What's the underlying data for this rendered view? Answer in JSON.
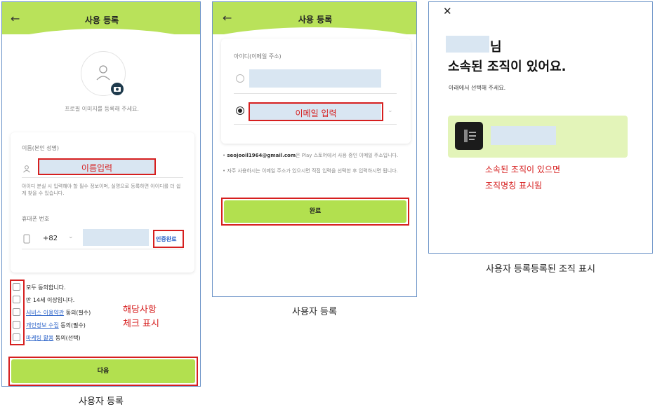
{
  "screen1": {
    "title": "사용 등록",
    "back_icon": "←",
    "profile_hint": "프로필 이미지를 등록해 주세요.",
    "name_label": "이름(본인 성명)",
    "name_annotation": "이름입력",
    "name_help": "아이디 분실 시 입력해야 할 필수 정보이며, 실명으로 등록하면 아이디를 더 쉽게 찾을 수 있습니다.",
    "phone_label": "휴대폰 번호",
    "country_code": "+82",
    "verify_button": "인증완료",
    "agreements": [
      {
        "link": "",
        "text": "모두 동의합니다."
      },
      {
        "link": "",
        "text": "만 14세 이상입니다."
      },
      {
        "link": "서비스 이용약관",
        "text": " 동의(필수)"
      },
      {
        "link": "개인정보 수집",
        "text": " 동의(필수)"
      },
      {
        "link": "마케팅 활용",
        "text": " 동의(선택)"
      }
    ],
    "check_annotation_line1": "해당사항",
    "check_annotation_line2": "체크 표시",
    "next_button": "다음",
    "caption": "사용자 등록"
  },
  "screen2": {
    "title": "사용 등록",
    "back_icon": "←",
    "id_label": "아이디(이메일 주소)",
    "email_annotation": "이메일 입력",
    "note1_email": "seojooil1964@gmail.com",
    "note1_rest": "은 Play 스토어에서 사용 중인 이메일 주소입니다.",
    "note2": "자주 사용하시는 이메일 주소가 있으시면 직접 입력을 선택한 후 입력하시면 됩니다.",
    "done_button": "완료",
    "caption": "사용자 등록"
  },
  "screen3": {
    "close_icon": "✕",
    "suffix": "님",
    "heading": "소속된 조직이 있어요.",
    "sub": "아래에서 선택해 주세요.",
    "annotation_line1": "소속된 조직이 있으면",
    "annotation_line2": "조직명칭 표시됨",
    "caption": "사용자 등록등록된 조직 표시"
  },
  "colors": {
    "accent_green": "#b2e04f",
    "annotation_red": "#d61f1f",
    "redacted_blue": "#d9e6f2"
  }
}
